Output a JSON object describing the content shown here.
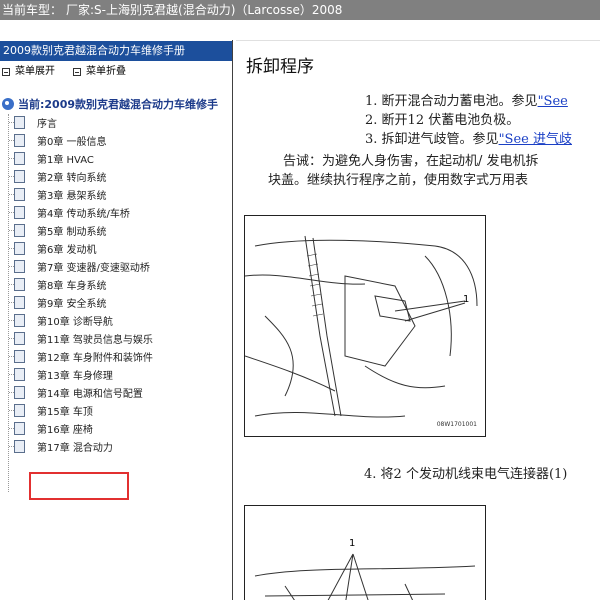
{
  "titlebar": {
    "label": "当前车型：",
    "model": "厂家:S-上海别克君越(混合动力)（Larcosse）2008"
  },
  "left": {
    "header": "2009款别克君越混合动力车维修手册",
    "toolbar": {
      "expand": "菜单展开",
      "collapse": "菜单折叠"
    },
    "root": "当前:2009款别克君越混合动力车维修手",
    "items": [
      "序言",
      "第0章 一般信息",
      "第1章 HVAC",
      "第2章 转向系统",
      "第3章 悬架系统",
      "第4章 传动系统/车桥",
      "第5章 制动系统",
      "第6章 发动机",
      "第7章 变速器/变速驱动桥",
      "第8章 车身系统",
      "第9章 安全系统",
      "第10章 诊断导航",
      "第11章 驾驶员信息与娱乐",
      "第12章 车身附件和装饰件",
      "第13章 车身修理",
      "第14章 电源和信号配置",
      "第15章 车顶",
      "第16章 座椅",
      "第17章 混合动力"
    ],
    "selected_index": 18
  },
  "right": {
    "title": "拆卸程序",
    "steps": [
      {
        "num": "1.",
        "text": "断开混合动力蓄电池。参见",
        "link": "\"See"
      },
      {
        "num": "2.",
        "text": "断开12 伏蓄电池负极。",
        "link": ""
      },
      {
        "num": "3.",
        "text": "拆卸进气歧管。参见",
        "link": "\"See 进气歧"
      }
    ],
    "caution_line1": "告诫：为避免人身伤害，在起动机/ 发电机拆",
    "caution_line2": "块盖。继续执行程序之前，使用数字式万用表",
    "figure1": {
      "callout": "1",
      "code": "08W1701001"
    },
    "step4": "4. 将2 个发动机线束电气连接器(1)",
    "figure2": {
      "callout": "1"
    }
  },
  "colors": {
    "titlebar": "#808080",
    "header": "#1c4f9c",
    "link": "#1a3fc5",
    "highlight": "#e23030"
  }
}
